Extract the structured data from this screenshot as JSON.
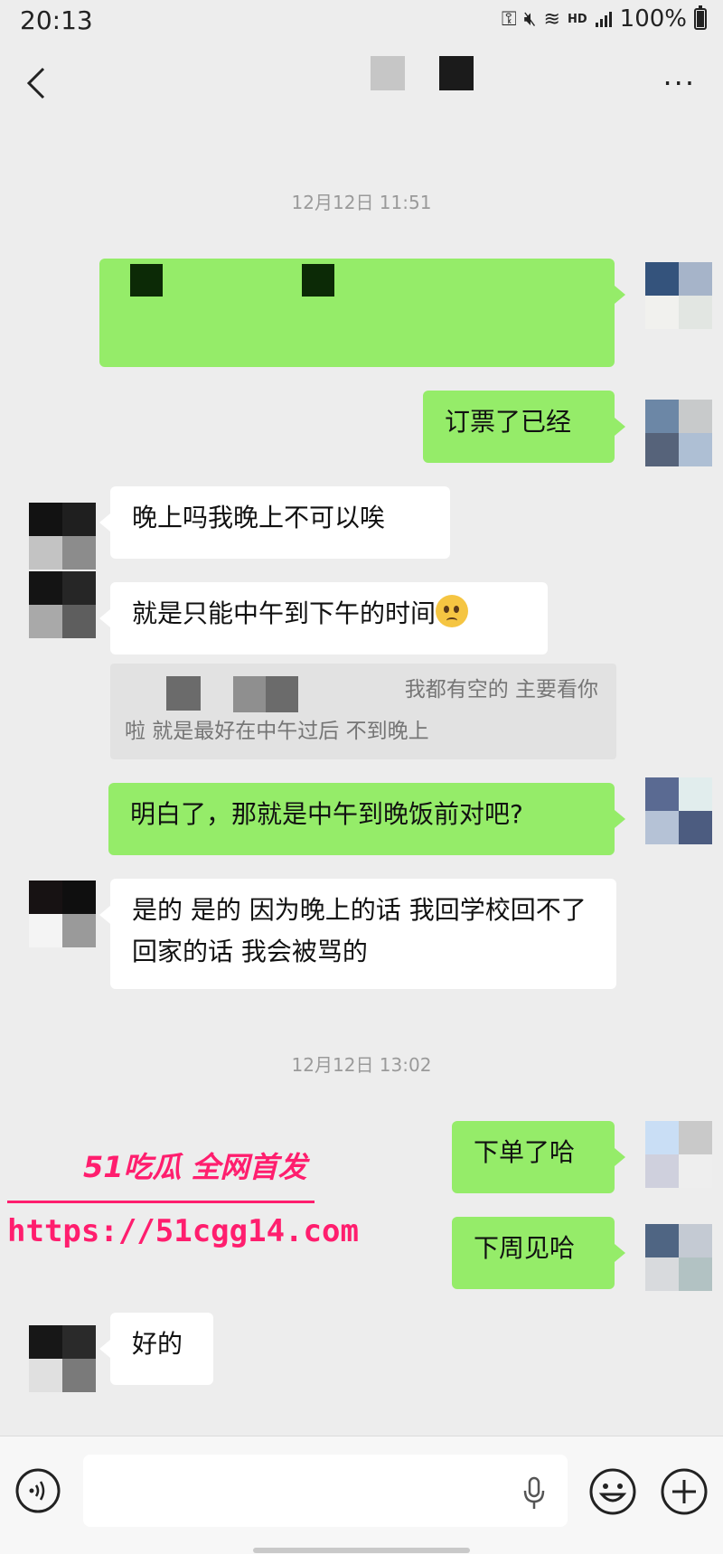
{
  "status_bar": {
    "time": "20:13",
    "battery": "100%",
    "hd_label": "HD",
    "icons": [
      "key-icon",
      "mute-icon",
      "wifi-icon",
      "signal-icon",
      "battery-icon"
    ]
  },
  "header": {
    "back_icon": "chevron-left-icon",
    "more_icon": "more-icon",
    "more_glyph": "···"
  },
  "timestamps": [
    "12月12日 11:51",
    "12月12日 13:02"
  ],
  "messages": [
    {
      "side": "sent",
      "text": ""
    },
    {
      "side": "sent",
      "text": "订票了已经"
    },
    {
      "side": "recv",
      "text": "晚上吗我晚上不可以唉"
    },
    {
      "side": "recv",
      "text": "就是只能中午到下午的时间",
      "emoji": "pleading-face-emoji"
    },
    {
      "side": "recv",
      "quote": [
        "我都有空的 主要看你",
        "啦 就是最好在中午过后 不到晚上"
      ]
    },
    {
      "side": "sent",
      "text": "明白了，那就是中午到晚饭前对吧?"
    },
    {
      "side": "recv",
      "text": "是的 是的 因为晚上的话 我回学校回不了 回家的话 我会被骂的"
    },
    {
      "side": "sent",
      "text": "下单了哈"
    },
    {
      "side": "sent",
      "text": "下周见哈"
    },
    {
      "side": "recv",
      "text": "好的"
    }
  ],
  "watermark": {
    "title": "51吃瓜 全网首发",
    "url": "https://51cgg14.com"
  },
  "input_bar": {
    "voice_icon": "voice-icon",
    "mic_icon": "microphone-icon",
    "emoji_icon": "smiley-icon",
    "plus_icon": "plus-icon",
    "input_value": ""
  }
}
